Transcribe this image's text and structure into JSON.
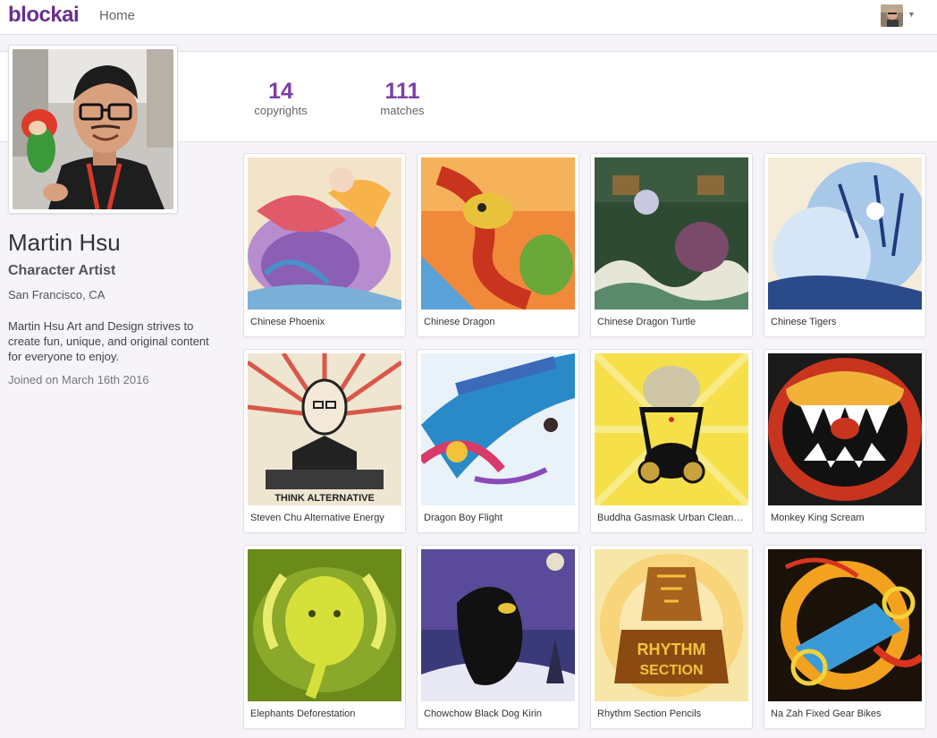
{
  "nav": {
    "brand": "blockai",
    "home_label": "Home"
  },
  "stats": [
    {
      "value": "14",
      "label": "copyrights"
    },
    {
      "value": "111",
      "label": "matches"
    }
  ],
  "profile": {
    "name": "Martin Hsu",
    "title": "Character Artist",
    "location": "San Francisco, CA",
    "bio": "Martin Hsu Art and Design strives to create fun, unique, and original content for everyone to enjoy.",
    "joined": "Joined on March 16th 2016"
  },
  "artworks": [
    {
      "title": "Chinese Phoenix"
    },
    {
      "title": "Chinese Dragon"
    },
    {
      "title": "Chinese Dragon Turtle"
    },
    {
      "title": "Chinese Tigers"
    },
    {
      "title": "Steven Chu Alternative Energy"
    },
    {
      "title": "Dragon Boy Flight"
    },
    {
      "title": "Buddha Gasmask Urban Cleansing"
    },
    {
      "title": "Monkey King Scream"
    },
    {
      "title": "Elephants Deforestation"
    },
    {
      "title": "Chowchow Black Dog Kirin"
    },
    {
      "title": "Rhythm Section Pencils"
    },
    {
      "title": "Na Zah Fixed Gear Bikes"
    }
  ],
  "art_text": {
    "think_alternative": "THINK ALTERNATIVE",
    "rhythm_section_1": "RHYTHM",
    "rhythm_section_2": "SECTION"
  },
  "colors": {
    "brand": "#6a2f8e",
    "stat_number": "#7b3fa7"
  }
}
